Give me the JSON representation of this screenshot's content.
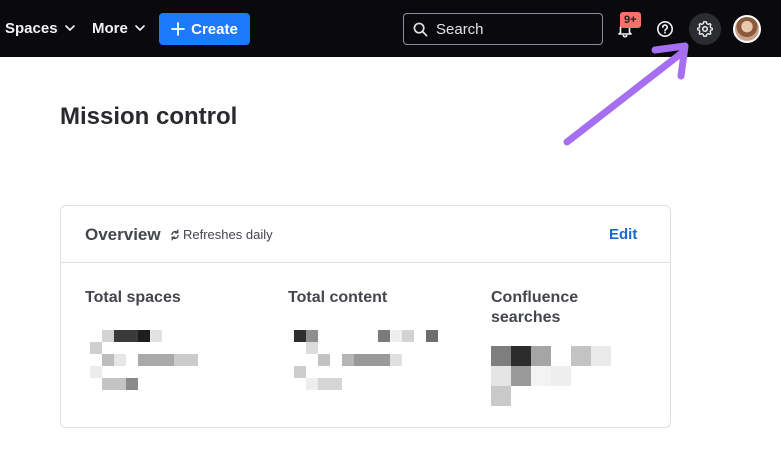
{
  "nav": {
    "spaces_label": "Spaces",
    "more_label": "More",
    "create_label": "Create",
    "search_placeholder": "Search",
    "notification_badge": "9+"
  },
  "icons": {
    "chevron": "chevron-down-icon",
    "plus": "plus-icon",
    "search": "search-icon",
    "bell": "bell-icon",
    "help": "question-circle-icon",
    "settings": "gear-icon",
    "refresh": "refresh-icon",
    "annotation": "arrow-annotation"
  },
  "colors": {
    "topbar": "#0a0a0e",
    "create_button": "#1d7afc",
    "badge": "#f87168",
    "annotation_arrow": "#a66ef0",
    "link": "#1868db"
  },
  "page": {
    "title": "Mission control"
  },
  "overview": {
    "title": "Overview",
    "refresh_text": "Refreshes daily",
    "edit_label": "Edit",
    "metrics": [
      {
        "label": "Total spaces",
        "value": "(redacted)"
      },
      {
        "label": "Total content",
        "value": "(redacted)"
      },
      {
        "label": "Confluence searches",
        "value": "(redacted)"
      }
    ]
  }
}
